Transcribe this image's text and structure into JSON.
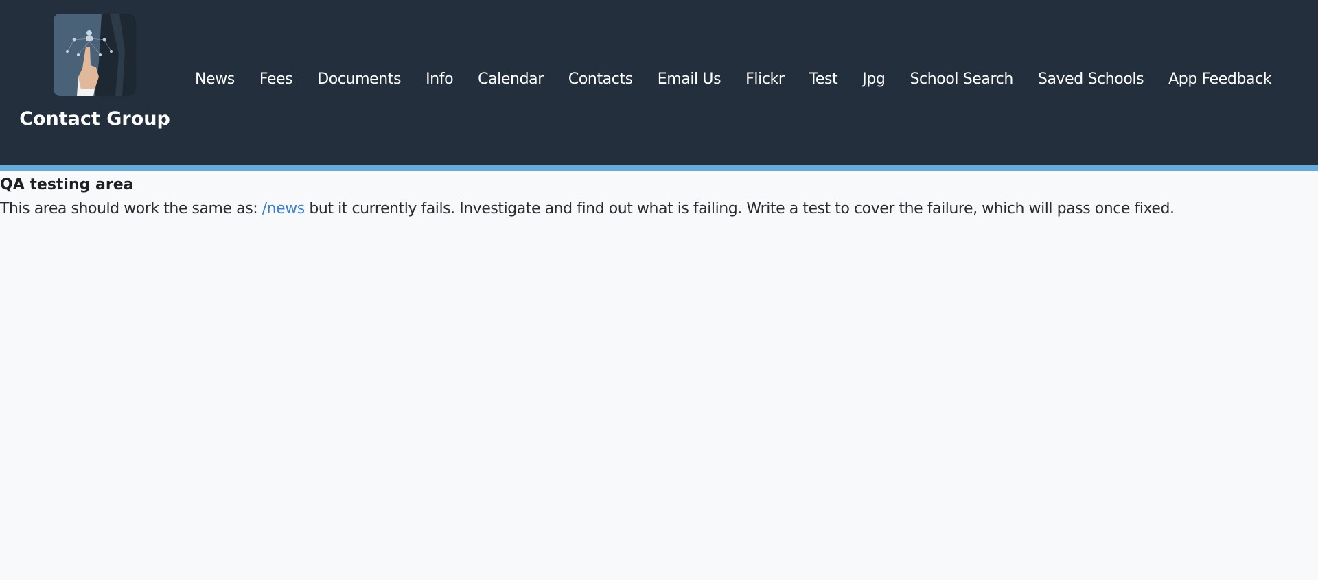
{
  "brand": {
    "title": "Contact Group",
    "logo_icon": "touchscreen-network-icon"
  },
  "nav": {
    "items": [
      {
        "label": "News"
      },
      {
        "label": "Fees"
      },
      {
        "label": "Documents"
      },
      {
        "label": "Info"
      },
      {
        "label": "Calendar"
      },
      {
        "label": "Contacts"
      },
      {
        "label": "Email Us"
      },
      {
        "label": "Flickr"
      },
      {
        "label": "Test"
      },
      {
        "label": "Jpg"
      },
      {
        "label": "School Search"
      },
      {
        "label": "Saved Schools"
      },
      {
        "label": "App Feedback"
      }
    ]
  },
  "main": {
    "heading": "QA testing area",
    "text_before_link": "This area should work the same as: ",
    "link_label": "/news",
    "text_after_link": " but it currently fails. Investigate and find out what is failing. Write a test to cover the failure, which will pass once fixed."
  },
  "colors": {
    "header_bg": "#232f3c",
    "accent_stripe": "#5eaee0",
    "page_bg": "#f7f9fb",
    "link": "#3a7fd5"
  }
}
